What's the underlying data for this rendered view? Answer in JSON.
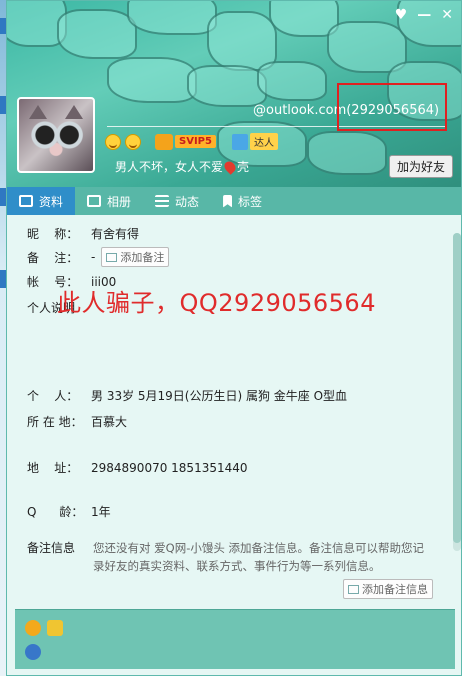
{
  "window": {
    "controls": [
      "♥",
      "—",
      "✕"
    ],
    "email": "@outlook.com(2929056564)"
  },
  "profile": {
    "svip_label": "SVIP5",
    "daren_label": "达人",
    "signature_before": "男人不坏，女人不爱",
    "signature_after": "壳",
    "add_friend_label": "加为好友"
  },
  "tabs": [
    {
      "label": "资料",
      "icon": "profile-card-icon"
    },
    {
      "label": "相册",
      "icon": "photo-album-icon"
    },
    {
      "label": "动态",
      "icon": "feed-list-icon"
    },
    {
      "label": "标签",
      "icon": "bookmark-icon"
    }
  ],
  "fields": {
    "nickname_label": "昵    称：",
    "nickname_value": "有舍有得",
    "remark_label": "备    注：",
    "remark_value": "-",
    "add_remark_label": "添加备注",
    "account_label": "帐    号：",
    "account_value": "iii00",
    "bio_label": "个人说明",
    "scam_text": "此人骗子，QQ2929056564",
    "person_label": "个    人：",
    "person_value": "男   33岁   5月19日(公历生日)   属狗   金牛座   O型血",
    "location_label": "所 在 地：",
    "location_value": "百慕大",
    "address_label": "地    址：",
    "address_value": "2984890070 1851351440",
    "qage_label": "Q      龄：",
    "qage_value": "1年",
    "note_label": "备注信息",
    "note_text": "您还没有对 爱Q网-小馒头 添加备注信息。备注信息可以帮助您记录好友的真实资料、联系方式、事件行为等一系列信息。",
    "add_remark2_label": "添加备注信息"
  },
  "colors": {
    "accent_tab": "#2f8ec9",
    "header_teal": "#3bb7a4",
    "warning_red": "#e02b2b"
  }
}
